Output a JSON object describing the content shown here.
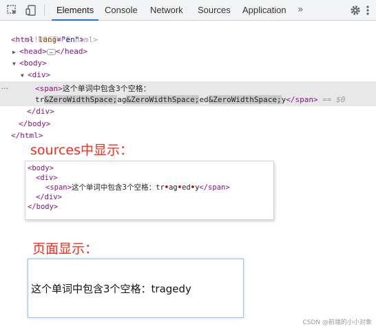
{
  "toolbar": {
    "tabs": [
      "Elements",
      "Console",
      "Network",
      "Sources",
      "Application"
    ],
    "more": "»"
  },
  "tree": {
    "doctype": "<!DOCTYPE html>",
    "html_open": "<html",
    "lang_attr": "lang",
    "lang_value": "\"en\"",
    "head": "<head>",
    "head_close": "</head>",
    "head_ellipsis": "…",
    "body_open": "<body>",
    "div_open": "<div>",
    "span_open": "<span>",
    "span_text": "这个单词中包含3个空格：",
    "span_line2_segments": [
      "tr",
      "&ZeroWidthSpace;",
      "ag",
      "&ZeroWidthSpace;",
      "ed",
      "&ZeroWidthSpace;",
      "y"
    ],
    "span_close": "</span>",
    "selected_marker": "== $0",
    "div_close": "</div>",
    "body_close": "</body>",
    "html_close": "</html>",
    "dots": "…"
  },
  "sources_caption": "sources中显示：",
  "sources_view": {
    "body_open": "<body>",
    "div_open": "<div>",
    "span_open": "<span>",
    "span_text": "这个单词中包含3个空格：",
    "word_parts": [
      "tr",
      "•",
      "ag",
      "•",
      "ed",
      "•",
      "y"
    ],
    "span_close": "</span>",
    "div_close": "</div>",
    "body_close": "</body>"
  },
  "page_caption": "页面显示：",
  "page_view": {
    "text": "这个单词中包含3个空格：tragedy"
  },
  "watermark": "CSDN @前端的小小对象",
  "colors": {
    "caption": "#ff2a1a",
    "tag": "#881280",
    "attr_name": "#994500",
    "attr_value": "#1a1aa6",
    "active_tab_underline": "#1a73e8",
    "zero_width_marker": "#c80000"
  }
}
